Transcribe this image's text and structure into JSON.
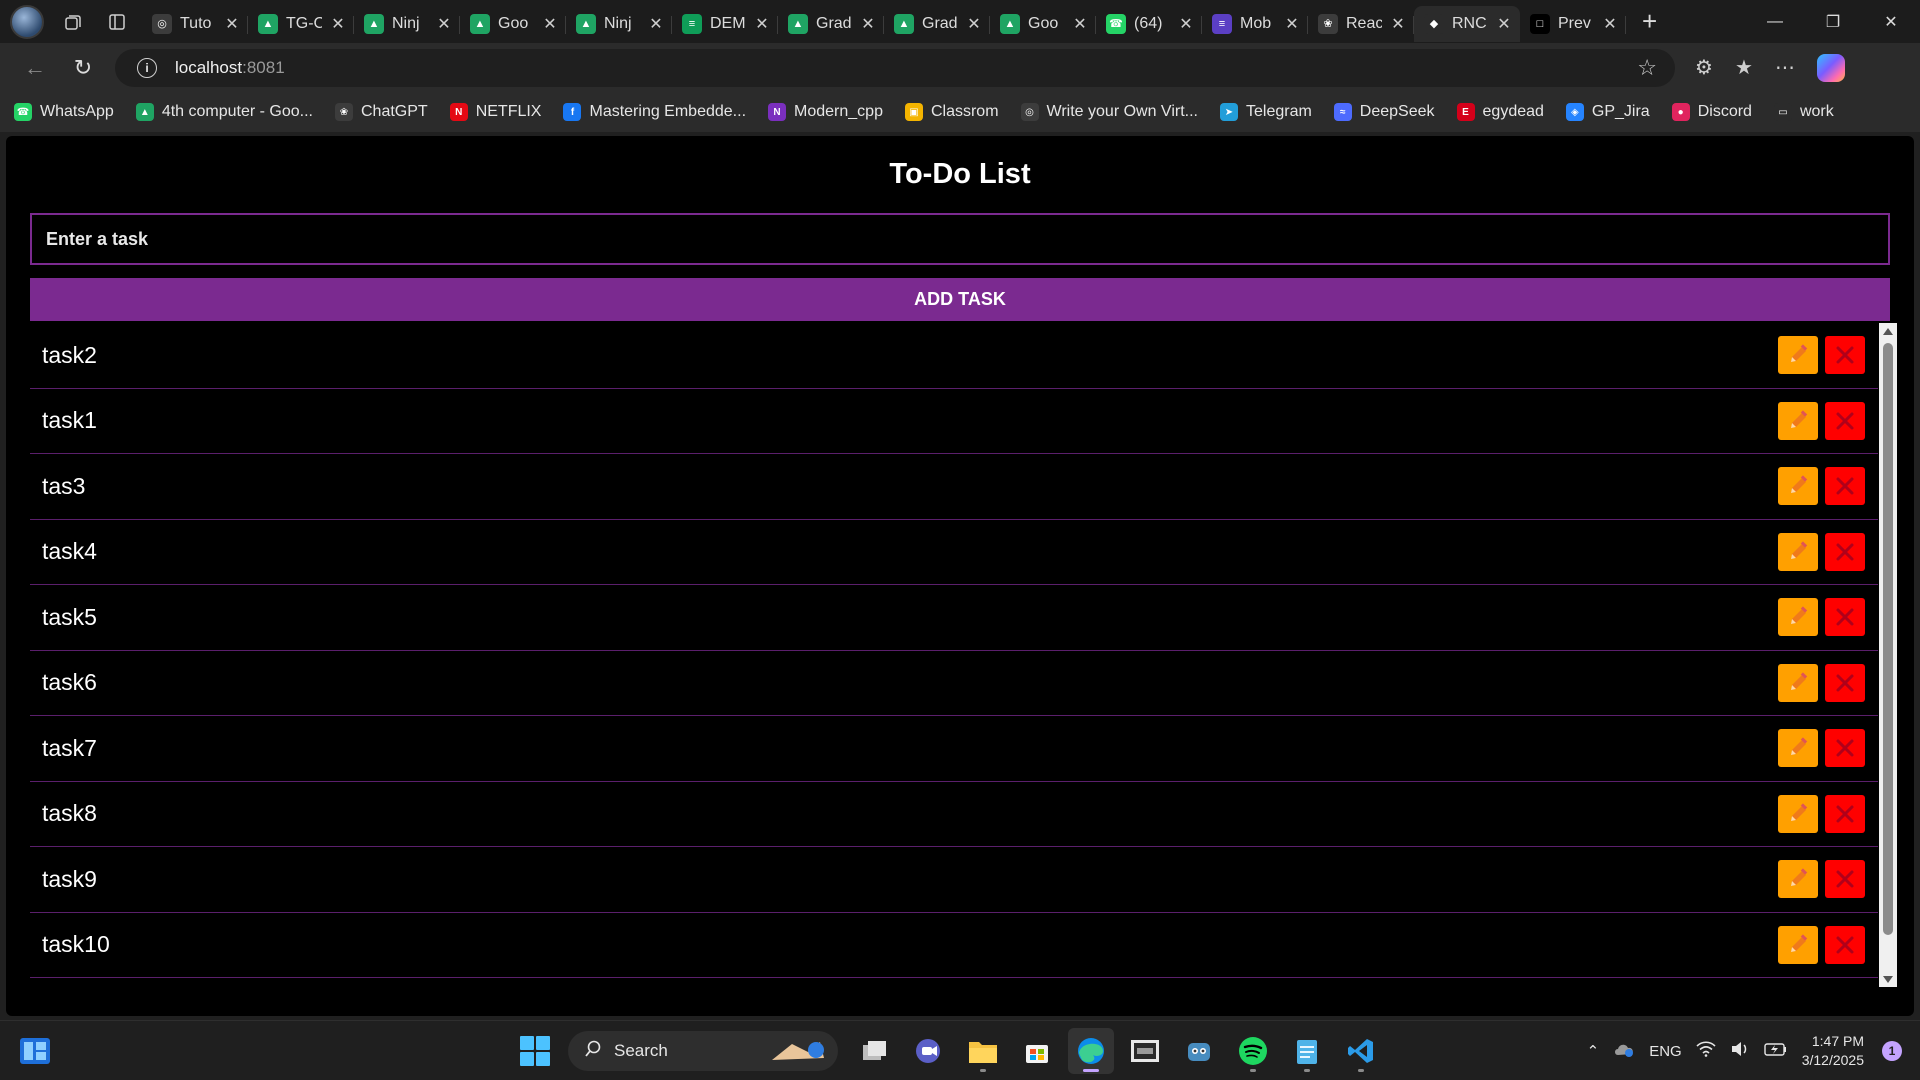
{
  "browser": {
    "tabs": [
      {
        "title": "Tuto",
        "icon": "globe-icon",
        "color": "#3c3c3c"
      },
      {
        "title": "TG-C",
        "icon": "google-drive-icon",
        "color": "#1fa463"
      },
      {
        "title": "Ninj",
        "icon": "google-drive-icon",
        "color": "#1fa463"
      },
      {
        "title": "Goo",
        "icon": "google-drive-icon",
        "color": "#1fa463"
      },
      {
        "title": "Ninj",
        "icon": "google-drive-icon",
        "color": "#1fa463"
      },
      {
        "title": "DEM",
        "icon": "google-sheets-icon",
        "color": "#0f9d58"
      },
      {
        "title": "Grad",
        "icon": "google-drive-icon",
        "color": "#1fa463"
      },
      {
        "title": "Grad",
        "icon": "google-drive-icon",
        "color": "#1fa463"
      },
      {
        "title": "Goo",
        "icon": "google-drive-icon",
        "color": "#1fa463"
      },
      {
        "title": "(64)",
        "icon": "whatsapp-icon",
        "color": "#25d366"
      },
      {
        "title": "Mob",
        "icon": "notes-icon",
        "color": "#5b3fc4"
      },
      {
        "title": "Reac",
        "icon": "chatgpt-icon",
        "color": "#3c3c3c"
      },
      {
        "title": "RNC",
        "icon": "expo-icon",
        "color": "#2b2b2b",
        "active": true
      },
      {
        "title": "Prev",
        "icon": "square-icon",
        "color": "#000000"
      }
    ],
    "address": {
      "host": "localhost",
      "port": ":8081"
    },
    "bookmarks": [
      {
        "label": "WhatsApp",
        "icon": "whatsapp-icon",
        "color": "#25d366"
      },
      {
        "label": "4th computer - Goo...",
        "icon": "google-drive-icon",
        "color": "#1fa463"
      },
      {
        "label": "ChatGPT",
        "icon": "chatgpt-icon",
        "color": "#3c3c3c"
      },
      {
        "label": "NETFLIX",
        "icon": "netflix-icon",
        "color": "#e50914"
      },
      {
        "label": "Mastering Embedde...",
        "icon": "facebook-icon",
        "color": "#1877f2"
      },
      {
        "label": "Modern_cpp",
        "icon": "onenote-icon",
        "color": "#7b2fbe"
      },
      {
        "label": "Classrom",
        "icon": "classroom-icon",
        "color": "#f4b400"
      },
      {
        "label": "Write your Own Virt...",
        "icon": "globe-icon",
        "color": "#3c3c3c"
      },
      {
        "label": "Telegram",
        "icon": "telegram-icon",
        "color": "#229ed9"
      },
      {
        "label": "DeepSeek",
        "icon": "deepseek-icon",
        "color": "#4d6bfe"
      },
      {
        "label": "egydead",
        "icon": "egydead-icon",
        "color": "#d4001a"
      },
      {
        "label": "GP_Jira",
        "icon": "jira-icon",
        "color": "#2684ff"
      },
      {
        "label": "Discord",
        "icon": "discord-icon",
        "color": "#e0245e"
      },
      {
        "label": "work",
        "icon": "folder-icon",
        "color": "#2b2b2b"
      }
    ]
  },
  "app": {
    "title": "To-Do List",
    "input_placeholder": "Enter a task",
    "add_button_label": "ADD TASK",
    "colors": {
      "accent": "#7b2a90",
      "edit": "#ffa000",
      "delete": "#ff0000"
    },
    "tasks": [
      "task2",
      "task1",
      "tas3",
      "task4",
      "task5",
      "task6",
      "task7",
      "task8",
      "task9",
      "task10"
    ]
  },
  "taskbar": {
    "search_label": "Search",
    "language": "ENG",
    "time": "1:47 PM",
    "date": "3/12/2025",
    "notification_count": "1"
  }
}
